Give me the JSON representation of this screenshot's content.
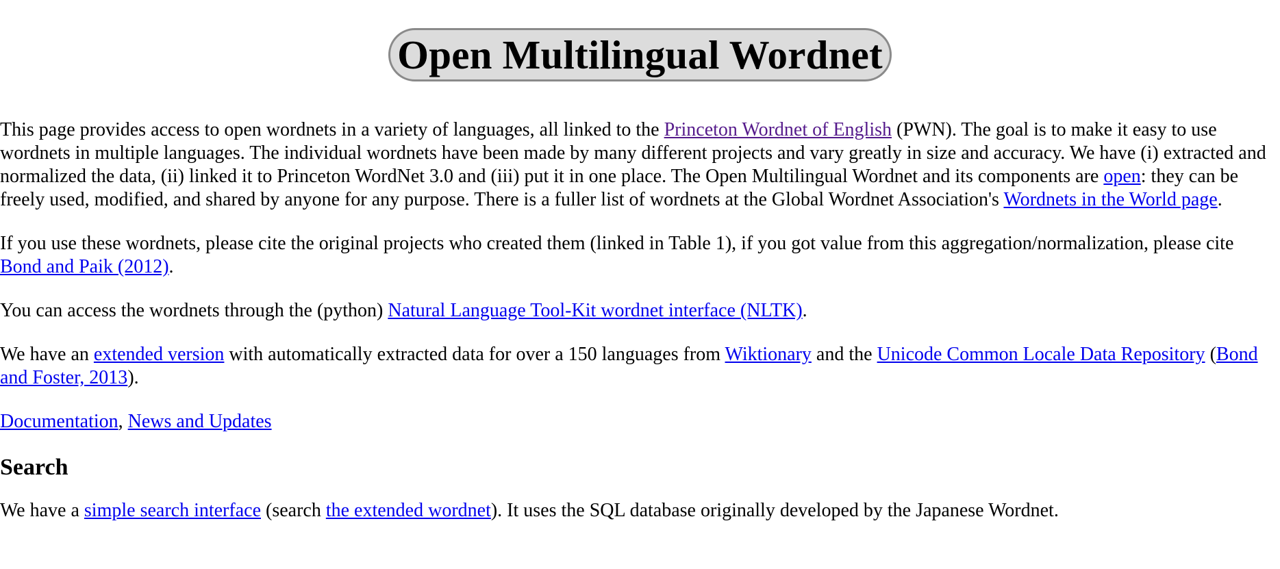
{
  "title": "Open Multilingual Wordnet",
  "intro": {
    "t1": "This page provides access to open wordnets in a variety of languages, all linked to the ",
    "link_pwn": "Princeton Wordnet of English",
    "t2": " (PWN). The goal is to make it easy to use wordnets in multiple languages. The individual wordnets have been made by many different projects and vary greatly in size and accuracy. We have (i) extracted and normalized the data, (ii) linked it to Princeton WordNet 3.0 and (iii) put it in one place. The Open Multilingual Wordnet and its components are ",
    "link_open": "open",
    "t3": ": they can be freely used, modified, and shared by anyone for any purpose. There is a fuller list of wordnets at the Global Wordnet Association's ",
    "link_world": "Wordnets in the World page",
    "t4": "."
  },
  "cite": {
    "t1": "If you use these wordnets, please cite the original projects who created them (linked in Table 1), if you got value from this aggregation/normalization, please cite ",
    "link_bond_paik": "Bond and Paik (2012)",
    "t2": "."
  },
  "nltk": {
    "t1": "You can access the wordnets through the (python) ",
    "link_nltk": "Natural Language Tool-Kit wordnet interface (NLTK)",
    "t2": "."
  },
  "extended": {
    "t1": "We have an ",
    "link_extended": "extended version",
    "t2": " with automatically extracted data for over a 150 languages from ",
    "link_wiktionary": "Wiktionary",
    "t3": " and the ",
    "link_cldr": "Unicode Common Locale Data Repository",
    "t4": " (",
    "link_bond_foster": "Bond and Foster, 2013",
    "t5": ")."
  },
  "links_line": {
    "link_docs": "Documentation",
    "sep": ", ",
    "link_news": "News and Updates"
  },
  "search": {
    "heading": "Search",
    "t1": "We have a ",
    "link_simple": "simple search interface",
    "t2": " (search ",
    "link_ext_wordnet": "the extended wordnet",
    "t3": "). It uses the SQL database originally developed by the Japanese Wordnet."
  },
  "colors": {
    "link": "#0000ee",
    "visited_link": "#551a8b",
    "title_bg": "#dcdcdc",
    "title_border": "#8a8a8a"
  }
}
